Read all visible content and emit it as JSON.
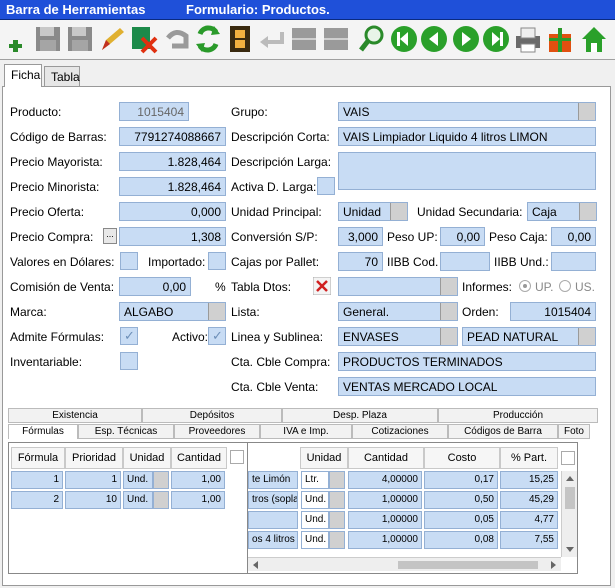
{
  "window": {
    "title_app": "Barra de Herramientas",
    "title_form": "Formulario: Productos."
  },
  "toolbar": {
    "buttons": [
      {
        "icon": "add-icon"
      },
      {
        "icon": "save-icon"
      },
      {
        "icon": "save-disabled-icon"
      },
      {
        "icon": "edit-icon"
      },
      {
        "icon": "delete-icon"
      },
      {
        "icon": "undo-icon"
      },
      {
        "icon": "refresh-icon"
      },
      {
        "icon": "film-icon"
      },
      {
        "icon": "back-arrow-icon"
      },
      {
        "icon": "disabled-icon"
      },
      {
        "icon": "disabled-icon"
      },
      {
        "icon": "search-icon"
      },
      {
        "icon": "first-icon"
      },
      {
        "icon": "prev-icon"
      },
      {
        "icon": "next-icon"
      },
      {
        "icon": "last-icon"
      },
      {
        "icon": "print-icon"
      },
      {
        "icon": "gift-icon"
      },
      {
        "icon": "home-icon"
      }
    ]
  },
  "tabs": [
    {
      "label": "Ficha"
    },
    {
      "label": "Tabla"
    }
  ],
  "form": {
    "producto_label": "Producto:",
    "producto_value": "1015404",
    "codigo_label": "Código de Barras:",
    "codigo_value": "7791274088667",
    "mayorista_label": "Precio Mayorista:",
    "mayorista_value": "1.828,464",
    "minorista_label": "Precio Minorista:",
    "minorista_value": "1.828,464",
    "oferta_label": "Precio Oferta:",
    "oferta_value": "0,000",
    "compra_label": "Precio Compra:",
    "compra_btn": "...",
    "compra_value": "1,308",
    "dolares_label": "Valores en Dólares:",
    "importado_label": "Importado:",
    "comision_label": "Comisión de Venta:",
    "comision_value": "0,00",
    "comision_unit": "%",
    "marca_label": "Marca:",
    "marca_value": "ALGABO",
    "formulas_label": "Admite Fórmulas:",
    "formulas_check": "✓",
    "activo_label": "Activo:",
    "activo_check": "✓",
    "inventariable_label": "Inventariable:",
    "grupo_label": "Grupo:",
    "grupo_value": "VAIS",
    "desc_corta_label": "Descripción Corta:",
    "desc_corta_value": "VAIS Limpiador Liquido 4 litros LIMON",
    "desc_larga_label": "Descripción Larga:",
    "desc_larga_value": "",
    "activa_larga_label": "Activa D. Larga:",
    "unidad_principal_label": "Unidad Principal:",
    "unidad_principal_value": "Unidad",
    "unidad_secundaria_label": "Unidad Secundaria:",
    "unidad_secundaria_value": "Caja",
    "conversion_label": "Conversión S/P:",
    "conversion_value": "3,000",
    "peso_up_label": "Peso UP:",
    "peso_up_value": "0,00",
    "peso_caja_label": "Peso Caja:",
    "peso_caja_value": "0,00",
    "cajas_label": "Cajas por Pallet:",
    "cajas_value": "70",
    "iibb_cod_label": "IIBB Cod.",
    "iibb_cod_value": "",
    "iibb_und_label": "IIBB Und.:",
    "iibb_und_value": "",
    "tabla_dtos_label": "Tabla Dtos:",
    "tabla_dtos_value": "",
    "informes_label": "Informes:",
    "informes_up": "UP.",
    "informes_us": "US.",
    "lista_label": "Lista:",
    "lista_value": "General.",
    "orden_label": "Orden:",
    "orden_value": "1015404",
    "linea_label": "Linea y Sublinea:",
    "linea_value": "ENVASES",
    "sublinea_value": "PEAD NATURAL",
    "cta_compra_label": "Cta. Cble Compra:",
    "cta_compra_value": "PRODUCTOS TERMINADOS",
    "cta_venta_label": "Cta. Cble Venta:",
    "cta_venta_value": "VENTAS MERCADO LOCAL"
  },
  "subtabs_row1": [
    {
      "label": "Existencia"
    },
    {
      "label": "Depósitos"
    },
    {
      "label": "Desp. Plaza"
    },
    {
      "label": "Producción"
    }
  ],
  "subtabs_row2": [
    {
      "label": "Fórmulas"
    },
    {
      "label": "Esp. Técnicas"
    },
    {
      "label": "Proveedores"
    },
    {
      "label": "IVA e Imp."
    },
    {
      "label": "Cotizaciones"
    },
    {
      "label": "Códigos de Barra"
    },
    {
      "label": "Foto"
    }
  ],
  "formulas_grid": {
    "headers": [
      "Fórmula",
      "Prioridad",
      "Unidad",
      "Cantidad"
    ],
    "rows": [
      {
        "formula": "1",
        "prioridad": "1",
        "unidad": "Und.",
        "cantidad": "1,00"
      },
      {
        "formula": "2",
        "prioridad": "10",
        "unidad": "Und.",
        "cantidad": "1,00"
      }
    ]
  },
  "components_grid": {
    "headers": [
      "Unidad",
      "Cantidad",
      "Costo",
      "% Part."
    ],
    "rows": [
      {
        "desc": "te Limón",
        "unidad": "Ltr.",
        "cantidad": "4,00000",
        "costo": "0,17",
        "part": "15,25"
      },
      {
        "desc": "tros (soplac",
        "unidad": "Und.",
        "cantidad": "1,00000",
        "costo": "0,50",
        "part": "45,29"
      },
      {
        "desc": "",
        "unidad": "Und.",
        "cantidad": "1,00000",
        "costo": "0,05",
        "part": "4,77"
      },
      {
        "desc": "os 4 litros",
        "unidad": "Und.",
        "cantidad": "1,00000",
        "costo": "0,08",
        "part": "7,55"
      }
    ]
  }
}
